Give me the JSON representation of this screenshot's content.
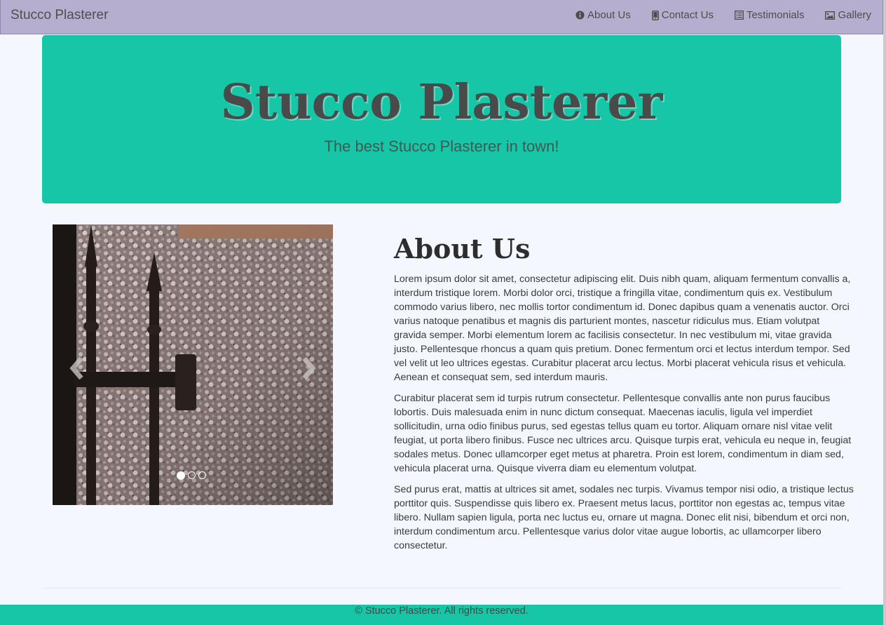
{
  "navbar": {
    "brand": "Stucco Plasterer",
    "items": [
      {
        "label": "About Us",
        "icon": "info-circle-icon"
      },
      {
        "label": "Contact Us",
        "icon": "mobile-phone-icon"
      },
      {
        "label": "Testimonials",
        "icon": "list-alt-icon"
      },
      {
        "label": "Gallery",
        "icon": "picture-icon"
      }
    ]
  },
  "hero": {
    "title": "Stucco Plasterer",
    "subtitle": "The best Stucco Plasterer in town!"
  },
  "carousel": {
    "slide_count": 3,
    "active_index": 0,
    "prev_icon": "chevron-left-icon",
    "next_icon": "chevron-right-icon"
  },
  "about": {
    "heading": "About Us",
    "paragraphs": [
      "Lorem ipsum dolor sit amet, consectetur adipiscing elit. Duis nibh quam, aliquam fermentum convallis a, interdum tristique lorem. Morbi dolor orci, tristique a fringilla vitae, condimentum quis ex. Vestibulum commodo varius libero, nec mollis tortor condimentum id. Donec dapibus quam a venenatis auctor. Orci varius natoque penatibus et magnis dis parturient montes, nascetur ridiculus mus. Etiam volutpat gravida semper. Morbi elementum lorem ac facilisis consectetur. In nec vestibulum mi, vitae gravida justo. Pellentesque rhoncus a quam quis pretium. Donec fermentum orci et lectus interdum tempor. Sed vel velit ut leo ultrices egestas. Curabitur placerat arcu lectus. Morbi placerat vehicula risus et vehicula. Aenean et consequat sem, sed interdum mauris.",
      "Curabitur placerat sem id turpis rutrum consectetur. Pellentesque convallis ante non purus faucibus lobortis. Duis malesuada enim in nunc dictum consequat. Maecenas iaculis, ligula vel imperdiet sollicitudin, urna odio finibus purus, sed egestas tellus quam eu tortor. Aliquam ornare nisl vitae velit feugiat, ut porta libero finibus. Fusce nec ultrices arcu. Quisque turpis erat, vehicula eu neque in, feugiat sodales metus. Donec ullamcorper eget metus at pharetra. Proin est lorem, condimentum in diam sed, vehicula placerat urna. Quisque viverra diam eu elementum volutpat.",
      "Sed purus erat, mattis at ultrices sit amet, sodales nec turpis. Vivamus tempor nisi odio, a tristique lectus porttitor quis. Suspendisse quis libero ex. Praesent metus lacus, porttitor non egestas ac, tempus vitae libero. Nullam sapien ligula, porta nec luctus eu, ornare ut magna. Donec elit nisi, bibendum et orci non, interdum condimentum arcu. Pellentesque varius dolor vitae augue lobortis, ac ullamcorper libero consectetur."
    ]
  },
  "footer": {
    "text": "© Stucco Plasterer. All rights reserved."
  },
  "colors": {
    "navbar": "#b6aecf",
    "accent": "#17c6a6",
    "background": "#f4f8fe"
  }
}
